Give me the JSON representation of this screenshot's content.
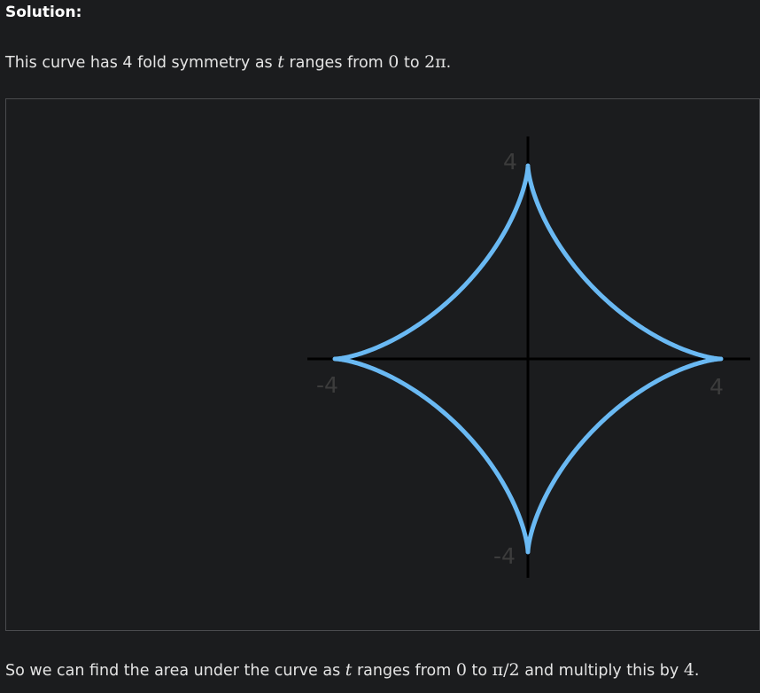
{
  "heading": "Solution:",
  "para1": {
    "text_a": "This curve has 4 fold symmetry as ",
    "var_t": "t",
    "text_b": " ranges from ",
    "zero": "0",
    "text_c": " to ",
    "two_pi": "2π",
    "text_d": "."
  },
  "para2": {
    "text_a": "So we can find the area under the curve as ",
    "var_t": "t",
    "text_b": " ranges from ",
    "zero": "0",
    "text_c": " to ",
    "pi_over_2": "π/2",
    "text_d": " and multiply this by ",
    "four": "4",
    "text_e": "."
  },
  "chart_data": {
    "type": "line",
    "title": "",
    "xlabel": "",
    "ylabel": "",
    "xlim": [
      -4,
      4
    ],
    "ylim": [
      -4,
      4
    ],
    "grid": false,
    "series": [
      {
        "param_range": [
          0,
          6.283185
        ],
        "x_expression": "4 cos(t)^3",
        "y_expression": "4 sin(t)^3",
        "color": "#6ab9f3"
      }
    ],
    "x_tick_labels": {
      "left": "-4",
      "right": "4"
    },
    "y_tick_labels": {
      "top": "4",
      "bottom": "-4"
    },
    "axis_color": "#000000",
    "label_color": "#3c3c3c"
  }
}
